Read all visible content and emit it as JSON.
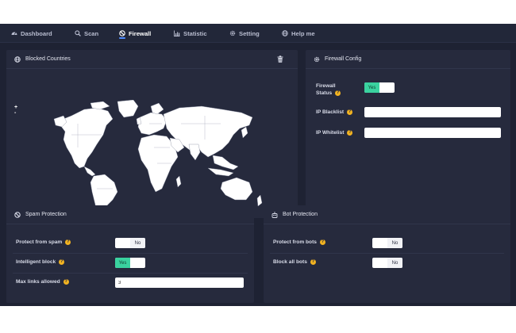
{
  "nav": {
    "items": [
      {
        "label": "Dashboard",
        "icon": "dashboard-icon"
      },
      {
        "label": "Scan",
        "icon": "search-icon"
      },
      {
        "label": "Firewall",
        "icon": "ban-icon",
        "active": true
      },
      {
        "label": "Statistic",
        "icon": "bar-chart-icon"
      },
      {
        "label": "Setting",
        "icon": "gear-icon"
      },
      {
        "label": "Help me",
        "icon": "globe-icon"
      }
    ]
  },
  "blocked_countries": {
    "title": "Blocked Countries",
    "zoom_in": "+",
    "zoom_out": "-"
  },
  "firewall_config": {
    "title": "Firewall Config",
    "status_label_1": "Firewall",
    "status_label_2": "Status",
    "status_value": "Yes",
    "ip_blacklist_label": "IP Blacklist",
    "ip_blacklist_value": "",
    "ip_whitelist_label": "IP Whitelist",
    "ip_whitelist_value": ""
  },
  "spam_protection": {
    "title": "Spam Protection",
    "protect_label": "Protect from spam",
    "protect_value": "No",
    "intelligent_label": "Intelligent block",
    "intelligent_value": "Yes",
    "max_links_label": "Max links allowed",
    "max_links_value": "3"
  },
  "bot_protection": {
    "title": "Bot Protection",
    "protect_label": "Protect from bots",
    "protect_value": "No",
    "block_all_label": "Block all bots",
    "block_all_value": "No"
  },
  "colors": {
    "background": "#1e2233",
    "card": "#262a3d",
    "accent_on": "#3ad29f",
    "help": "#f2b321",
    "active_nav": "#4f8cff"
  }
}
